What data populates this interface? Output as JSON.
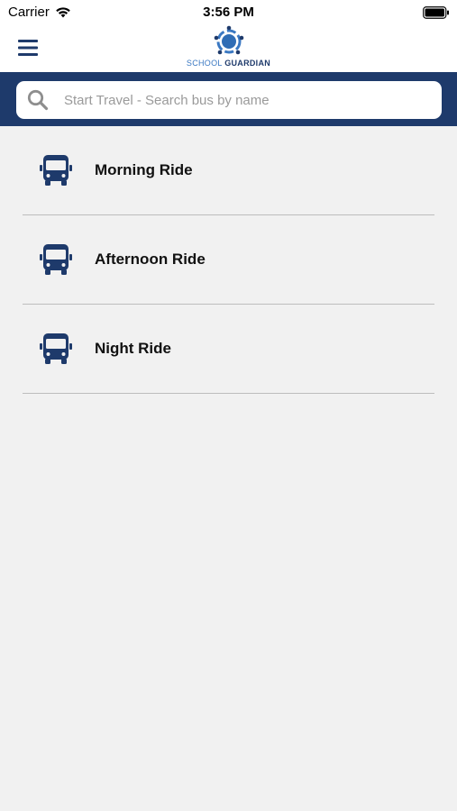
{
  "status_bar": {
    "carrier": "Carrier",
    "time": "3:56 PM"
  },
  "header": {
    "logo_word_1": "SCHOOL",
    "logo_word_2": "GUARDIAN",
    "icons": {
      "menu": "hamburger-menu-icon",
      "logo": "school-guardian-logo-icon"
    }
  },
  "search": {
    "placeholder": "Start Travel - Search bus by name",
    "value": ""
  },
  "rides": [
    {
      "label": "Morning Ride",
      "icon": "bus-icon"
    },
    {
      "label": "Afternoon Ride",
      "icon": "bus-icon"
    },
    {
      "label": "Night Ride",
      "icon": "bus-icon"
    }
  ],
  "colors": {
    "brand_navy": "#1e3a6b",
    "brand_blue": "#3a78c2",
    "background": "#f1f1f1"
  }
}
